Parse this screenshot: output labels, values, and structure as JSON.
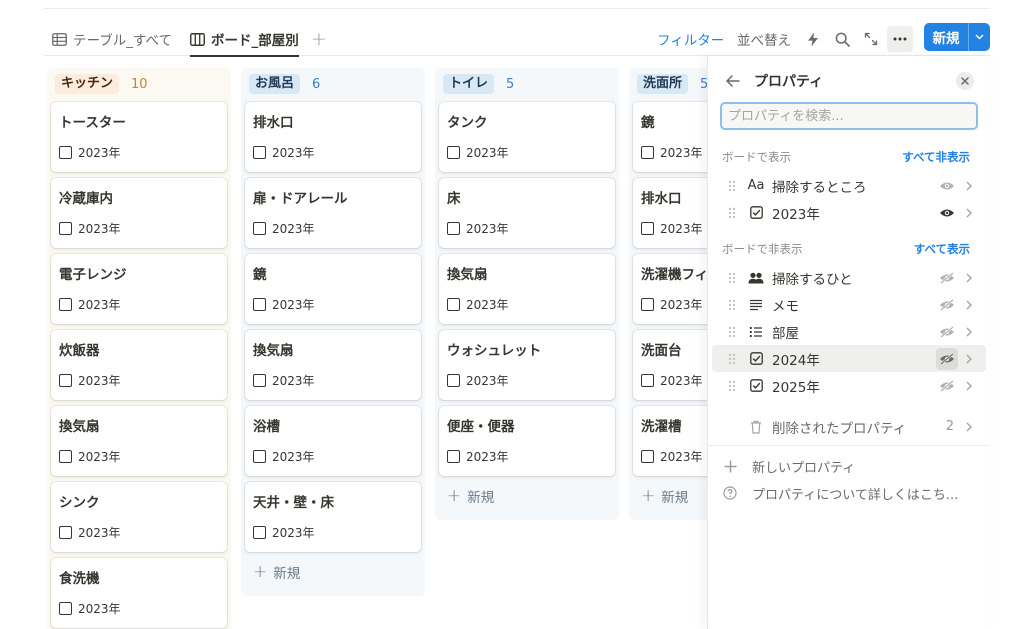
{
  "views": [
    {
      "label": "テーブル_すべて",
      "icon": "table-icon",
      "active": false
    },
    {
      "label": "ボード_部屋別",
      "icon": "board-icon",
      "active": true
    }
  ],
  "toolbar": {
    "add_view": "+",
    "filter_label": "フィルター",
    "sort_label": "並べ替え",
    "new_label": "新規"
  },
  "board": {
    "add_label": "新規",
    "columns": [
      {
        "name": "キッチン",
        "count": "10",
        "pill_bg": "#fbecdd",
        "pill_fg": "#49290e",
        "bg": "#fcf9f2",
        "count_fg": "#c9871d",
        "cards": [
          {
            "title": "トースター",
            "prop": "2023年"
          },
          {
            "title": "冷蔵庫内",
            "prop": "2023年"
          },
          {
            "title": "電子レンジ",
            "prop": "2023年"
          },
          {
            "title": "炊飯器",
            "prop": "2023年"
          },
          {
            "title": "換気扇",
            "prop": "2023年"
          },
          {
            "title": "シンク",
            "prop": "2023年"
          },
          {
            "title": "食洗機",
            "prop": "2023年"
          }
        ]
      },
      {
        "name": "お風呂",
        "count": "6",
        "pill_bg": "#d9e8f5",
        "pill_fg": "#1f3a57",
        "bg": "#f4f8fb",
        "count_fg": "#3d80c4",
        "cards": [
          {
            "title": "排水口",
            "prop": "2023年"
          },
          {
            "title": "扉・ドアレール",
            "prop": "2023年"
          },
          {
            "title": "鏡",
            "prop": "2023年"
          },
          {
            "title": "換気扇",
            "prop": "2023年"
          },
          {
            "title": "浴槽",
            "prop": "2023年"
          },
          {
            "title": "天井・壁・床",
            "prop": "2023年"
          }
        ]
      },
      {
        "name": "トイレ",
        "count": "5",
        "pill_bg": "#d9e8f5",
        "pill_fg": "#1f3a57",
        "bg": "#f4f8fb",
        "count_fg": "#3d80c4",
        "cards": [
          {
            "title": "タンク",
            "prop": "2023年"
          },
          {
            "title": "床",
            "prop": "2023年"
          },
          {
            "title": "換気扇",
            "prop": "2023年"
          },
          {
            "title": "ウォシュレット",
            "prop": "2023年"
          },
          {
            "title": "便座・便器",
            "prop": "2023年"
          }
        ]
      },
      {
        "name": "洗面所",
        "count": "5",
        "pill_bg": "#d9e8f5",
        "pill_fg": "#1f3a57",
        "bg": "#f4f8fb",
        "count_fg": "#3d80c4",
        "cards": [
          {
            "title": "鏡",
            "prop": "2023年"
          },
          {
            "title": "排水口",
            "prop": "2023年"
          },
          {
            "title": "洗濯機フィ",
            "prop": "2023年"
          },
          {
            "title": "洗面台",
            "prop": "2023年"
          },
          {
            "title": "洗濯槽",
            "prop": "2023年"
          }
        ]
      }
    ]
  },
  "panel": {
    "title": "プロパティ",
    "search_placeholder": "プロパティを検索...",
    "shown_header": "ボードで表示",
    "hide_all": "すべて非表示",
    "hidden_header": "ボードで非表示",
    "show_all": "すべて表示",
    "shown": [
      {
        "type_icon": "text-type-icon",
        "type_text": "Aa",
        "label": "掃除するところ",
        "visible": true
      },
      {
        "type_icon": "checkbox-type-icon",
        "type_text": "",
        "label": "2023年",
        "visible": true
      }
    ],
    "hidden": [
      {
        "type_icon": "person-type-icon",
        "label": "掃除するひと"
      },
      {
        "type_icon": "text-lines-type-icon",
        "label": "メモ"
      },
      {
        "type_icon": "list-type-icon",
        "label": "部屋"
      },
      {
        "type_icon": "checkbox-type-icon",
        "label": "2024年"
      },
      {
        "type_icon": "checkbox-type-icon",
        "label": "2025年"
      }
    ],
    "deleted_label": "削除されたプロパティ",
    "deleted_count": "2",
    "new_property": "新しいプロパティ",
    "learn_more": "プロパティについて詳しくはこち..."
  },
  "colors": {
    "accent": "#2383e2",
    "text": "#37352f",
    "muted": "#9b9a97"
  }
}
